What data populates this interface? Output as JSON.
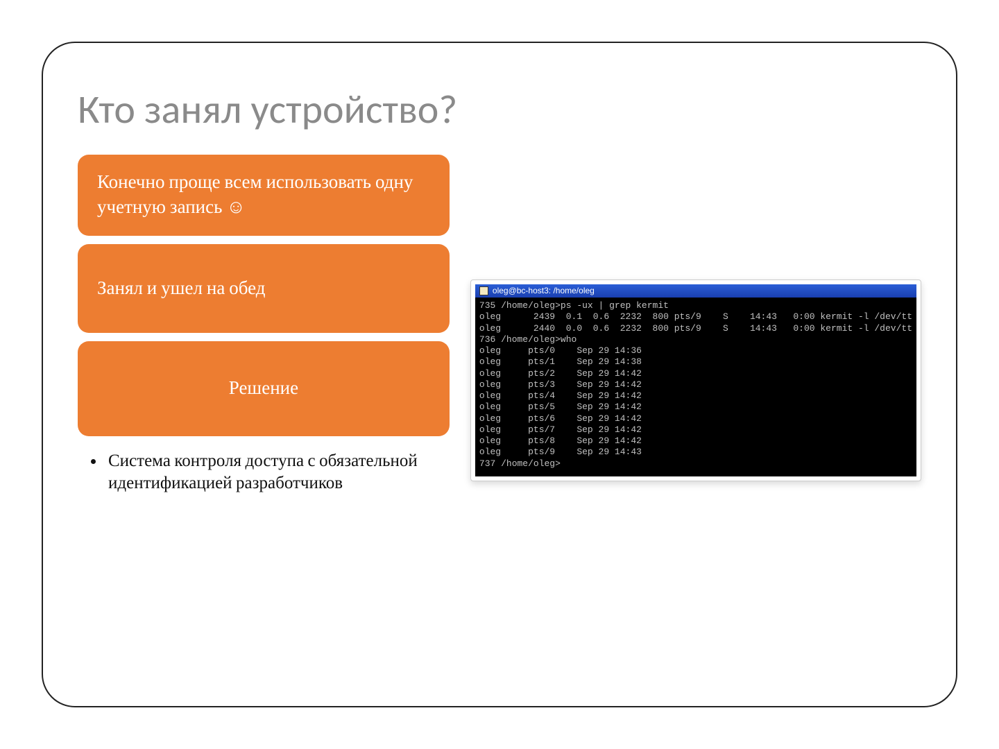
{
  "title": "Кто занял устройство?",
  "box1": "Конечно проще всем использовать одну учетную запись ☺",
  "box2": "Занял и ушел на обед",
  "box3": "Решение",
  "bullet": "Система контроля доступа с обязательной идентификацией разработчиков",
  "terminal": {
    "window_title": "oleg@bc-host3: /home/oleg",
    "lines": [
      "735 /home/oleg>ps -ux | grep kermit",
      "oleg      2439  0.1  0.6  2232  800 pts/9    S    14:43   0:00 kermit -l /dev/tt",
      "oleg      2440  0.0  0.6  2232  800 pts/9    S    14:43   0:00 kermit -l /dev/tt",
      "736 /home/oleg>who",
      "oleg     pts/0    Sep 29 14:36",
      "oleg     pts/1    Sep 29 14:38",
      "oleg     pts/2    Sep 29 14:42",
      "oleg     pts/3    Sep 29 14:42",
      "oleg     pts/4    Sep 29 14:42",
      "oleg     pts/5    Sep 29 14:42",
      "oleg     pts/6    Sep 29 14:42",
      "oleg     pts/7    Sep 29 14:42",
      "oleg     pts/8    Sep 29 14:42",
      "oleg     pts/9    Sep 29 14:43",
      "737 /home/oleg>"
    ]
  }
}
